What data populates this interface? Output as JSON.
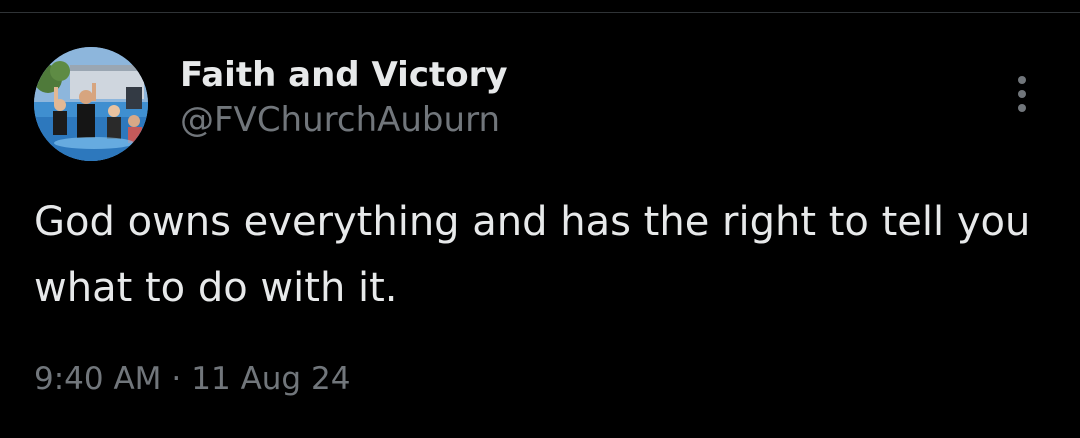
{
  "tweet": {
    "author": {
      "display_name": "Faith and Victory",
      "handle": "@FVChurchAuburn",
      "avatar_icon": "avatar-photo"
    },
    "text": "God owns everything and has the right to tell you what to do with it.",
    "time": "9:40 AM",
    "separator": "·",
    "date": "11 Aug 24",
    "more_icon": "more-vertical-icon"
  },
  "colors": {
    "background": "#000000",
    "primary_text": "#e7e9ea",
    "secondary_text": "#71767b",
    "divider": "#2f3336"
  }
}
